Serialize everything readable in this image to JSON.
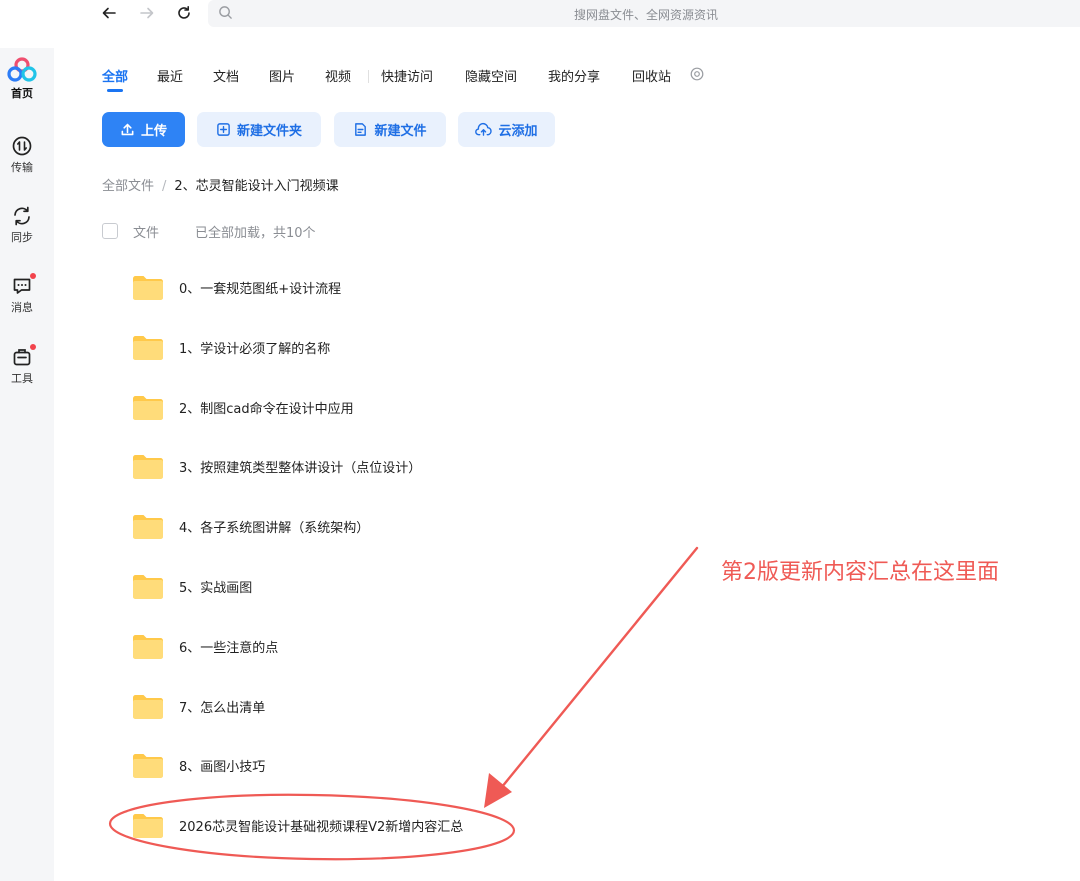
{
  "topbar": {
    "search_placeholder": "搜网盘文件、全网资源资讯"
  },
  "sidebar": {
    "items": [
      {
        "label": "首页",
        "icon": "home-logo-icon"
      },
      {
        "label": "传输",
        "icon": "transfer-icon"
      },
      {
        "label": "同步",
        "icon": "sync-icon"
      },
      {
        "label": "消息",
        "icon": "message-icon"
      },
      {
        "label": "工具",
        "icon": "toolbox-icon"
      }
    ]
  },
  "tabs": [
    {
      "label": "全部"
    },
    {
      "label": "最近"
    },
    {
      "label": "文档"
    },
    {
      "label": "图片"
    },
    {
      "label": "视频"
    },
    {
      "label": "快捷访问"
    },
    {
      "label": "隐藏空间"
    },
    {
      "label": "我的分享"
    },
    {
      "label": "回收站"
    }
  ],
  "toolbar": {
    "upload_label": "上传",
    "new_folder_label": "新建文件夹",
    "new_file_label": "新建文件",
    "cloud_add_label": "云添加"
  },
  "breadcrumb": {
    "root": "全部文件",
    "separator": "/",
    "current": "2、芯灵智能设计入门视频课"
  },
  "list_header": {
    "file_col": "文件",
    "count_text": "已全部加载，共10个"
  },
  "files": [
    {
      "name": "0、一套规范图纸+设计流程"
    },
    {
      "name": "1、学设计必须了解的名称"
    },
    {
      "name": "2、制图cad命令在设计中应用"
    },
    {
      "name": "3、按照建筑类型整体讲设计（点位设计）"
    },
    {
      "name": "4、各子系统图讲解（系统架构）"
    },
    {
      "name": "5、实战画图"
    },
    {
      "name": "6、一些注意的点"
    },
    {
      "name": "7、怎么出清单"
    },
    {
      "name": "8、画图小技巧"
    },
    {
      "name": "2026芯灵智能设计基础视频课程V2新增内容汇总"
    }
  ],
  "annotation": {
    "text": "第2版更新内容汇总在这里面",
    "color": "#ef5a55"
  },
  "colors": {
    "accent": "#1a74f2",
    "folder": "#ffd25c",
    "badge": "#f2434c"
  }
}
